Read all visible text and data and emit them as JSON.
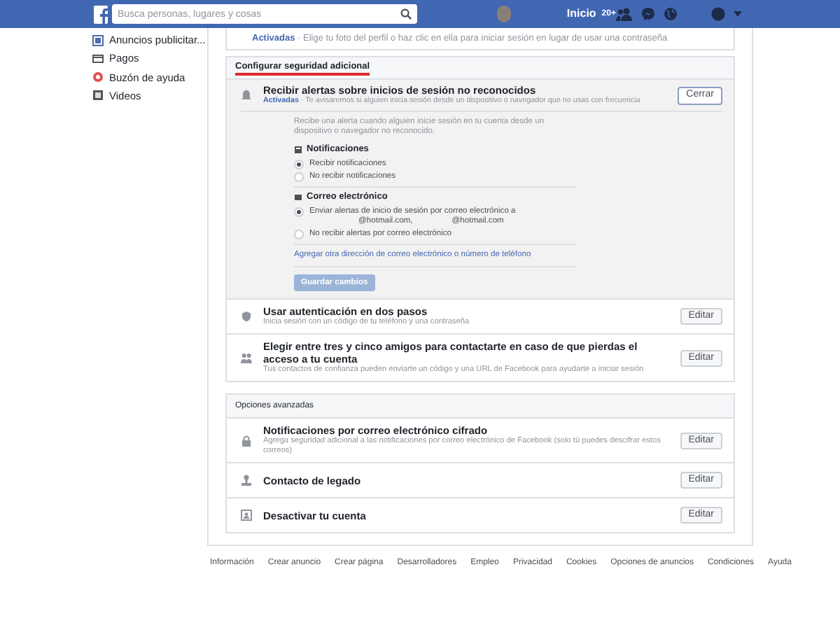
{
  "header": {
    "search_placeholder": "Busca personas, lugares y cosas",
    "home": "Inicio",
    "badge": "20+"
  },
  "sidebar": {
    "items": [
      {
        "label": "Anuncios publicitar..."
      },
      {
        "label": "Pagos"
      },
      {
        "label": "Buzón de ayuda"
      },
      {
        "label": "Videos"
      }
    ]
  },
  "top_row": {
    "status": "Activadas",
    "description": "· Elige tu foto del perfil o haz clic en ella para iniciar sesión en lugar de usar una contraseña"
  },
  "extra_security": {
    "title": "Configurar seguridad adicional",
    "alert": {
      "title": "Recibir alertas sobre inicios de sesión no reconocidos",
      "status": "Activadas",
      "description": "· Te avisaremos si alguien inicia sesión desde un dispositivo o navegador que no usas con frecuencia",
      "button": "Cerrar",
      "intro": "Recibe una alerta cuando alguien inicie sesión en tu cuenta desde un dispositivo o navegador no reconocido.",
      "groups": [
        {
          "heading": "Notificaciones",
          "options": [
            {
              "label": "Recibir notificaciones",
              "selected": true
            },
            {
              "label": "No recibir notificaciones",
              "selected": false
            }
          ]
        },
        {
          "heading": "Correo electrónico",
          "options": [
            {
              "label": "Enviar alertas de inicio de sesión por correo electrónico a",
              "addresses": [
                "@hotmail.com,",
                "@hotmail.com"
              ],
              "selected": true
            },
            {
              "label": "No recibir alertas por correo electrónico",
              "selected": false
            }
          ]
        }
      ],
      "add_link": "Agregar otra dirección de correo electrónico o número de teléfono",
      "save_button": {
        "label": "Guardar cambios",
        "disabled": true
      }
    },
    "rows": [
      {
        "title": "Usar autenticación en dos pasos",
        "description": "Inicia sesión con un código de tu teléfono y una contraseña",
        "button": "Editar"
      },
      {
        "title": "Elegir entre tres y cinco amigos para contactarte en caso de que pierdas el acceso a tu cuenta",
        "description": "Tus contactos de confianza pueden enviarte un código y una URL de Facebook para ayudarte a iniciar sesión",
        "button": "Editar"
      }
    ]
  },
  "advanced": {
    "title": "Opciones avanzadas",
    "rows": [
      {
        "title": "Notificaciones por correo electrónico cifrado",
        "description": "Agrega seguridad adicional a las notificaciones por correo electrónico de Facebook (solo tú puedes descifrar estos correos)",
        "button": "Editar"
      },
      {
        "title": "Contacto de legado",
        "button": "Editar"
      },
      {
        "title": "Desactivar tu cuenta",
        "button": "Editar"
      }
    ]
  },
  "footer": [
    "Información",
    "Crear anuncio",
    "Crear página",
    "Desarrolladores",
    "Empleo",
    "Privacidad",
    "Cookies",
    "Opciones de anuncios",
    "Condiciones",
    "Ayuda"
  ]
}
